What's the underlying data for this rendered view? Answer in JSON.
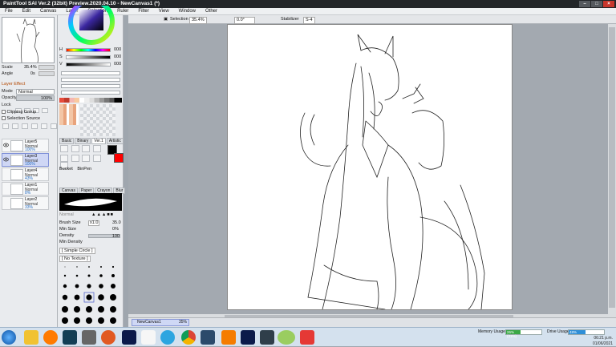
{
  "window": {
    "title": "PaintTool SAI Ver.2 (32bit) Preview.2020.04.10 - NewCanvas1 (*)",
    "min": "–",
    "max": "□",
    "close": "×"
  },
  "menu": [
    "File",
    "Edit",
    "Canvas",
    "Layer",
    "Selection",
    "Ruler",
    "Filter",
    "View",
    "Window",
    "Other"
  ],
  "left": {
    "scale_label": "Scale",
    "scale_value": "35.4%",
    "angle_label": "Angle",
    "angle_value": "0s",
    "hsv": {
      "h": "000",
      "s": "000",
      "v": "000"
    },
    "layer_effect": "Layer Effect",
    "mode_label": "Mode",
    "mode_value": "Normal",
    "opacity_label": "Opacity",
    "opacity_value": "100%",
    "lock_label": "Lock",
    "clipping_group": "Clipping Group",
    "selection_source": "Selection Source",
    "layers": [
      {
        "name": "Layer5",
        "mode": "Normal",
        "opacity": "100%"
      },
      {
        "name": "Layer3",
        "mode": "Normal",
        "opacity": "100%"
      },
      {
        "name": "Layer4",
        "mode": "Normal",
        "opacity": "43%"
      },
      {
        "name": "Layer1",
        "mode": "Normal",
        "opacity": "8%"
      },
      {
        "name": "Layer2",
        "mode": "Normal",
        "opacity": "33%"
      }
    ]
  },
  "tools": {
    "tabs": [
      "Basic",
      "Binary",
      "Ver.1",
      "Artistic"
    ],
    "bucket": "Bucket",
    "binpen": "BinPen",
    "subtabs": [
      "Canvas",
      "Paper",
      "Crayon",
      "Blur"
    ],
    "blend_label": "Normal",
    "brush_size_label": "Brush Size",
    "brush_size_mult": "x1.0",
    "brush_size_value": "35.0",
    "min_size_label": "Min Size",
    "min_size_value": "0%",
    "density_label": "Density",
    "density_value": "100",
    "min_density_label": "Min Density",
    "circle_label": "[ Simple Circle ]",
    "texture_label": "[ No Texture ]",
    "dot_sizes": [
      "1",
      "1.5",
      "2",
      "2.3",
      "2.6",
      "3",
      "3.5",
      "4",
      "5",
      "6",
      "7",
      "8",
      "9",
      "10",
      "12",
      "14",
      "16",
      "20",
      "25",
      "30",
      "35",
      "40",
      "50",
      "60",
      "70",
      "80",
      "100",
      "120",
      "160",
      "200"
    ]
  },
  "workspace": {
    "selection_label": "Selection",
    "zoom": "35.4%",
    "angle": "0.0°",
    "stabilizer_label": "Stabilizer",
    "stabilizer_value": "S-4"
  },
  "status": {
    "doc_name": "NewCanvas1",
    "doc_zoom": "35%"
  },
  "taskbar": {
    "memory_label": "Memory Usage",
    "memory_value": "26% (31%)",
    "drive_label": "Drive Usage",
    "drive_value": "48%",
    "time": "06:21 p.m.",
    "date": "01/06/2021"
  }
}
